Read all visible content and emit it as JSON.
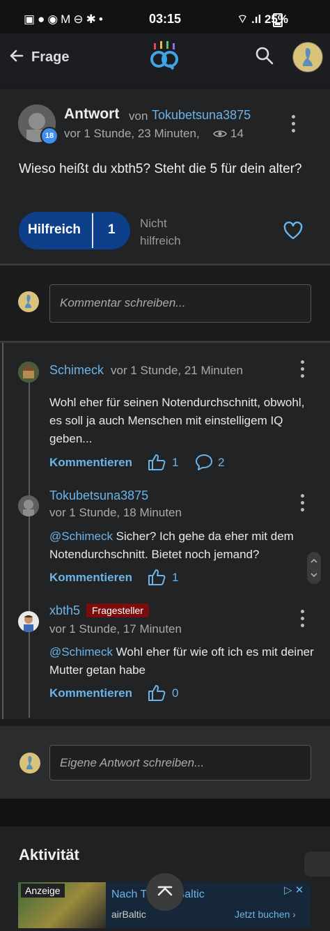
{
  "status_bar": {
    "left_icons": "▣●◉M⊖✱•",
    "time": "03:15",
    "signal": "⌔ .ıl",
    "battery": "25%"
  },
  "appbar": {
    "title": "Frage",
    "icons": [
      "back-arrow-icon",
      "gf-logo-icon",
      "search-icon",
      "user-avatar"
    ]
  },
  "answer": {
    "label": "Antwort",
    "von": "von",
    "author": "Tokubetsuna3875",
    "level": "18",
    "meta": "vor 1 Stunde, 23 Minuten,",
    "views": "14",
    "text": "Wieso heißt du xbth5? Steht die 5 für dein alter?",
    "helpful_label": "Hilfreich",
    "helpful_count": "1",
    "not_helpful": "Nicht hilfreich"
  },
  "comment_input": {
    "placeholder": "Kommentar schreiben..."
  },
  "comments": [
    {
      "user": "Schimeck",
      "time": "vor 1 Stunde, 21 Minuten",
      "text": "Wohl eher für seinen Notendurchschnitt, obwohl, es soll ja auch Menschen mit einstelligem IQ geben...",
      "action": "Kommentieren",
      "likes": "1",
      "replies": "2"
    },
    {
      "user": "Tokubetsuna3875",
      "time": "vor 1 Stunde, 18 Minuten",
      "mention": "@Schimeck",
      "text": " Sicher? Ich gehe da eher mit dem Notendurchschnitt. Bietet noch jemand?",
      "action": "Kommentieren",
      "likes": "1"
    },
    {
      "user": "xbth5",
      "badge": "Fragesteller",
      "time": "vor 1 Stunde, 17 Minuten",
      "mention": "@Schimeck",
      "text": " Wohl eher für wie oft ich es mit deiner Mutter getan habe",
      "action": "Kommentieren",
      "likes": "0"
    }
  ],
  "own_answer": {
    "placeholder": "Eigene Antwort schreiben..."
  },
  "activity": {
    "title": "Aktivität"
  },
  "ad": {
    "label": "Anzeige",
    "title": "Nach T    nit airBaltic",
    "brand": "airBaltic",
    "cta": "Jetzt buchen",
    "chevron": "›",
    "icons": "▷ ✕"
  },
  "colors": {
    "accent": "#6cb4e8",
    "helpful_bg": "#0d3f8a",
    "badge_bg": "#7a0d0d"
  }
}
